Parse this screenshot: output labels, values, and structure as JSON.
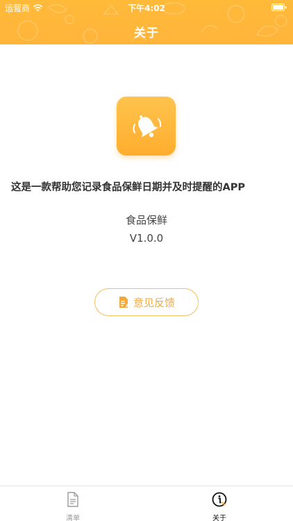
{
  "status_bar": {
    "carrier": "运营商",
    "time": "下午4:02"
  },
  "header": {
    "title": "关于"
  },
  "about": {
    "description": "这是一款帮助您记录食品保鲜日期并及时提醒的APP",
    "app_name": "食品保鲜",
    "version": "V1.0.0",
    "feedback_label": "意见反馈"
  },
  "tabs": [
    {
      "label": "清单",
      "icon": "document-icon",
      "active": false
    },
    {
      "label": "关于",
      "icon": "info-icon",
      "active": true
    }
  ],
  "colors": {
    "accent": "#ffb43a",
    "feedback_border": "#f7bd5e",
    "feedback_text": "#f2a93a",
    "tab_inactive": "#9a9a9a",
    "tab_active": "#111111"
  }
}
